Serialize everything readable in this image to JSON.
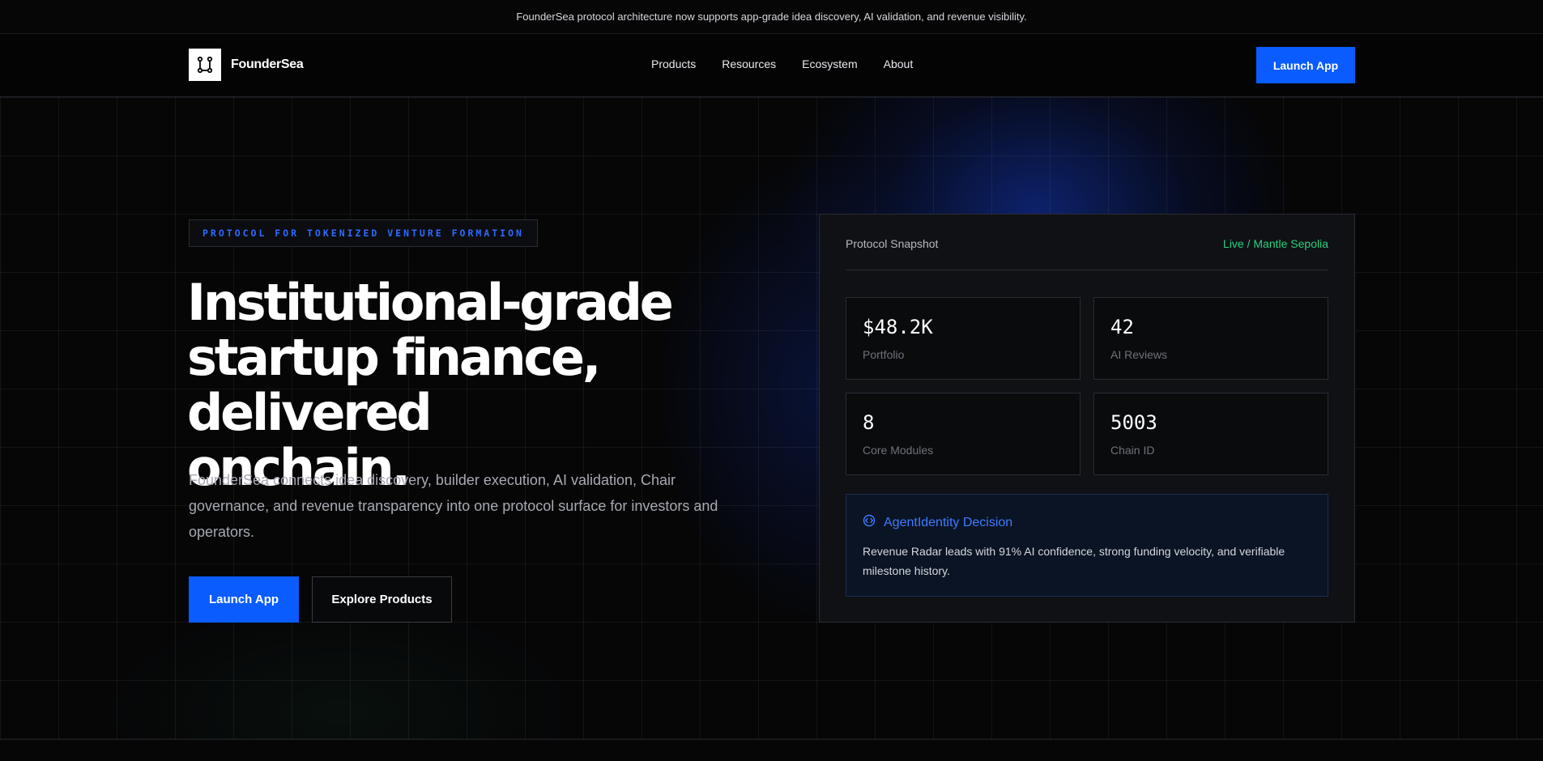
{
  "announcement": {
    "text": "FounderSea protocol architecture now supports app-grade idea discovery, AI validation, and revenue visibility."
  },
  "nav": {
    "brand": "FounderSea",
    "links": [
      "Products",
      "Resources",
      "Ecosystem",
      "About"
    ],
    "cta": "Launch App"
  },
  "hero": {
    "eyebrow": "PROTOCOL FOR TOKENIZED VENTURE FORMATION",
    "headline_lines": [
      "Institutional-grade",
      "startup finance, delivered",
      "onchain."
    ],
    "lede": "FounderSea connects idea discovery, builder execution, AI validation, Chair governance, and revenue transparency into one protocol surface for investors and operators.",
    "primary_button": "Launch App",
    "secondary_button": "Explore Products"
  },
  "snapshot": {
    "title": "Protocol Snapshot",
    "status": "Live / Mantle Sepolia",
    "stats": [
      {
        "value": "$48.2K",
        "label": "Portfolio"
      },
      {
        "value": "42",
        "label": "AI Reviews"
      },
      {
        "value": "8",
        "label": "Core Modules"
      },
      {
        "value": "5003",
        "label": "Chain ID"
      }
    ],
    "decision": {
      "icon": "code-brackets-icon",
      "title": "AgentIdentity Decision",
      "body": "Revenue Radar leads with 91% AI confidence, strong funding velocity, and verifiable milestone history."
    }
  },
  "colors": {
    "accent": "#0a5cff",
    "status_live": "#27d17f",
    "eyebrow_text": "#2f6bff"
  }
}
